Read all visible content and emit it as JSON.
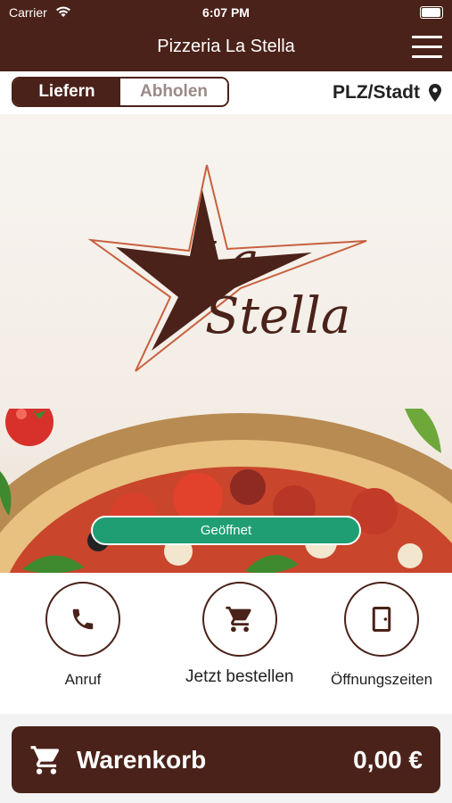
{
  "status_bar": {
    "carrier": "Carrier",
    "time": "6:07 PM"
  },
  "nav": {
    "title": "Pizzeria La Stella"
  },
  "mode_toggle": {
    "options": [
      "Liefern",
      "Abholen"
    ],
    "selected": "Liefern"
  },
  "location": {
    "label": "PLZ/Stadt"
  },
  "hero": {
    "logo_text": [
      "La",
      "Stella"
    ],
    "status": "Geöffnet"
  },
  "actions": [
    {
      "label": "Anruf",
      "icon": "phone-icon"
    },
    {
      "label": "Jetzt bestellen",
      "icon": "cart-icon"
    },
    {
      "label": "Öffnungszeiten",
      "icon": "door-icon"
    }
  ],
  "cart": {
    "label": "Warenkorb",
    "total": "0,00 €"
  },
  "colors": {
    "brand": "#4a2219",
    "open_status": "#1f9e73"
  }
}
